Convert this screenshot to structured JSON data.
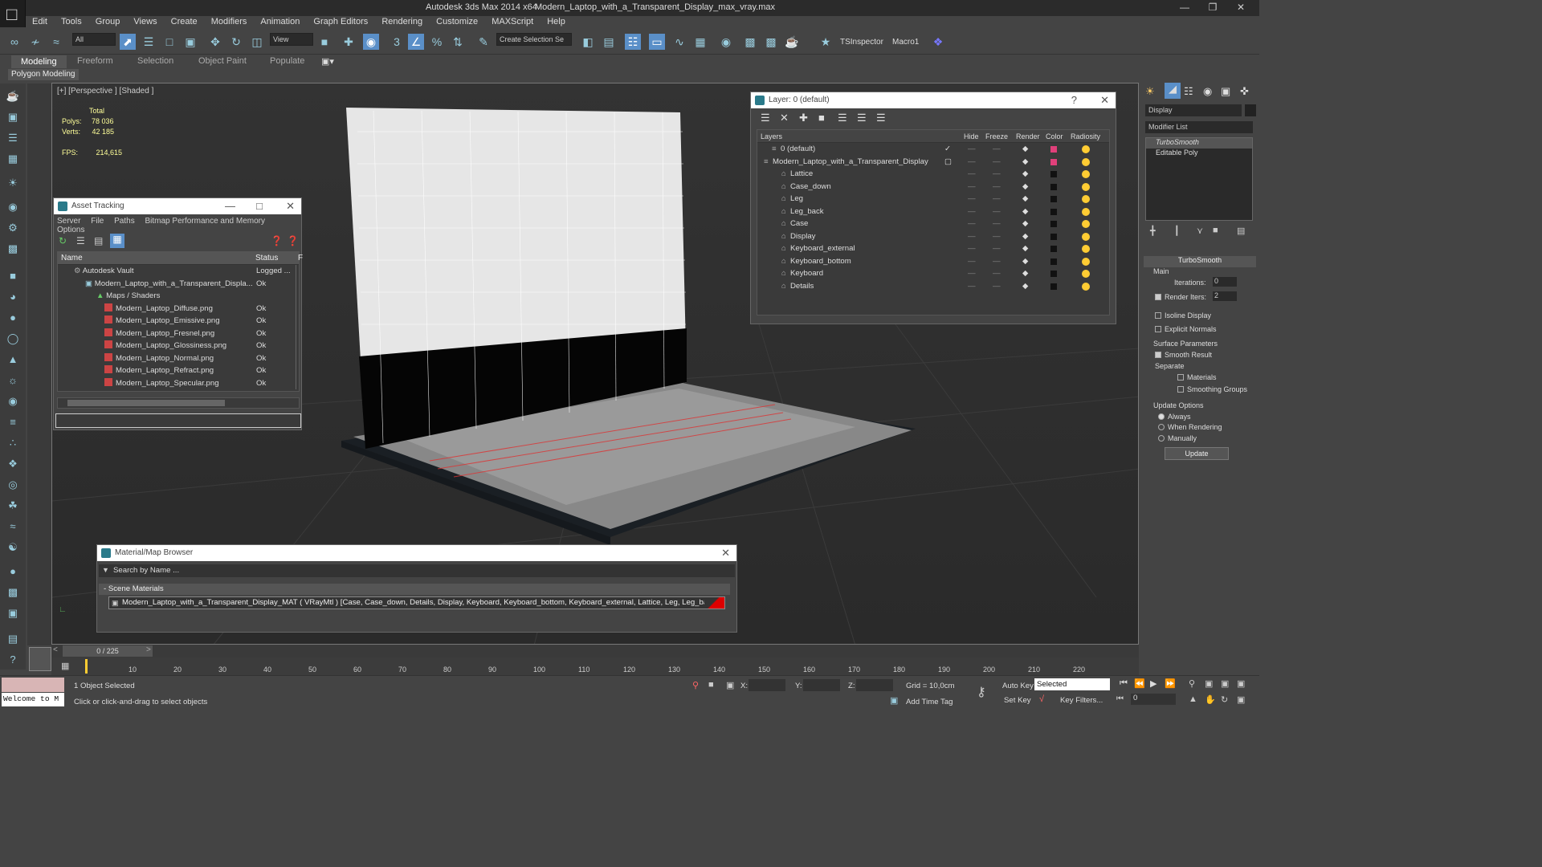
{
  "window": {
    "app_title": "Autodesk 3ds Max  2014 x64",
    "file_title": "Modern_Laptop_with_a_Transparent_Display_max_vray.max"
  },
  "menu": [
    "Edit",
    "Tools",
    "Group",
    "Views",
    "Create",
    "Modifiers",
    "Animation",
    "Graph Editors",
    "Rendering",
    "Customize",
    "MAXScript",
    "Help"
  ],
  "toolbar": {
    "selection_filter": "All",
    "view_dropdown": "View",
    "create_selection_set": "Create Selection Se",
    "tsinspector": "TSInspector",
    "macro": "Macro1"
  },
  "ribbon": {
    "tabs": [
      "Modeling",
      "Freeform",
      "Selection",
      "Object Paint",
      "Populate"
    ],
    "sub_label": "Polygon Modeling"
  },
  "viewport": {
    "label": "[+] [Perspective ] [Shaded ]",
    "stats": {
      "total_label": "Total",
      "polys_label": "Polys:",
      "polys_value": "78 036",
      "verts_label": "Verts:",
      "verts_value": "42 185",
      "fps_label": "FPS:",
      "fps_value": "214,615"
    }
  },
  "asset_tracking": {
    "title": "Asset Tracking",
    "menu": [
      "Server",
      "File",
      "Paths",
      "Bitmap Performance and Memory",
      "Options"
    ],
    "col_name": "Name",
    "col_status": "Status",
    "col_extra": "F",
    "rows": [
      {
        "name": "Autodesk Vault",
        "status": "Logged ..."
      },
      {
        "name": "Modern_Laptop_with_a_Transparent_Displa...",
        "status": "Ok"
      },
      {
        "name": "Maps / Shaders",
        "status": ""
      },
      {
        "name": "Modern_Laptop_Diffuse.png",
        "status": "Ok"
      },
      {
        "name": "Modern_Laptop_Emissive.png",
        "status": "Ok"
      },
      {
        "name": "Modern_Laptop_Fresnel.png",
        "status": "Ok"
      },
      {
        "name": "Modern_Laptop_Glossiness.png",
        "status": "Ok"
      },
      {
        "name": "Modern_Laptop_Normal.png",
        "status": "Ok"
      },
      {
        "name": "Modern_Laptop_Refract.png",
        "status": "Ok"
      },
      {
        "name": "Modern_Laptop_Specular.png",
        "status": "Ok"
      }
    ]
  },
  "layer_panel": {
    "title": "Layer: 0 (default)",
    "help": "?",
    "cols": [
      "Layers",
      "Hide",
      "Freeze",
      "Render",
      "Color",
      "Radiosity"
    ],
    "rows": [
      {
        "name": "0 (default)",
        "color": "#e0407a"
      },
      {
        "name": "Modern_Laptop_with_a_Transparent_Display",
        "color": "#e0407a"
      },
      {
        "name": "Lattice",
        "color": "#111111"
      },
      {
        "name": "Case_down",
        "color": "#111111"
      },
      {
        "name": "Leg",
        "color": "#111111"
      },
      {
        "name": "Leg_back",
        "color": "#111111"
      },
      {
        "name": "Case",
        "color": "#111111"
      },
      {
        "name": "Display",
        "color": "#111111"
      },
      {
        "name": "Keyboard_external",
        "color": "#111111"
      },
      {
        "name": "Keyboard_bottom",
        "color": "#111111"
      },
      {
        "name": "Keyboard",
        "color": "#111111"
      },
      {
        "name": "Details",
        "color": "#111111"
      }
    ]
  },
  "command_panel": {
    "name_field": "Display",
    "modifier_list": "Modifier List",
    "stack": [
      "TurboSmooth",
      "Editable Poly"
    ],
    "rollout_title": "TurboSmooth",
    "main_label": "Main",
    "iterations_label": "Iterations:",
    "iterations_value": "0",
    "render_iters_label": "Render Iters:",
    "render_iters_value": "2",
    "isoline_label": "Isoline Display",
    "explicit_label": "Explicit Normals",
    "surface_label": "Surface Parameters",
    "smooth_label": "Smooth Result",
    "separate_label": "Separate",
    "materials_label": "Materials",
    "smoothing_groups_label": "Smoothing Groups",
    "update_options_label": "Update Options",
    "always_label": "Always",
    "when_rendering_label": "When Rendering",
    "manually_label": "Manually",
    "update_button": "Update"
  },
  "material_browser": {
    "title": "Material/Map Browser",
    "search_placeholder": "Search by Name ...",
    "section": "- Scene Materials",
    "item": "Modern_Laptop_with_a_Transparent_Display_MAT ( VRayMtl ) [Case, Case_down, Details, Display, Keyboard, Keyboard_bottom, Keyboard_external, Lattice, Leg, Leg_back]"
  },
  "timeline": {
    "frame": "0 / 225",
    "ticks": [
      "10",
      "20",
      "30",
      "40",
      "50",
      "60",
      "70",
      "80",
      "90",
      "100",
      "110",
      "120",
      "130",
      "140",
      "150",
      "160",
      "170",
      "180",
      "190",
      "200",
      "210",
      "220"
    ]
  },
  "status": {
    "welcome": "Welcome to M",
    "selected": "1 Object Selected",
    "hint": "Click or click-and-drag to select objects",
    "x_label": "X:",
    "y_label": "Y:",
    "z_label": "Z:",
    "grid": "Grid = 10,0cm",
    "add_time_tag": "Add Time Tag",
    "auto_key": "Auto Key",
    "set_key": "Set Key",
    "selected_dropdown": "Selected",
    "key_filters": "Key Filters...",
    "frame_field": "0"
  }
}
